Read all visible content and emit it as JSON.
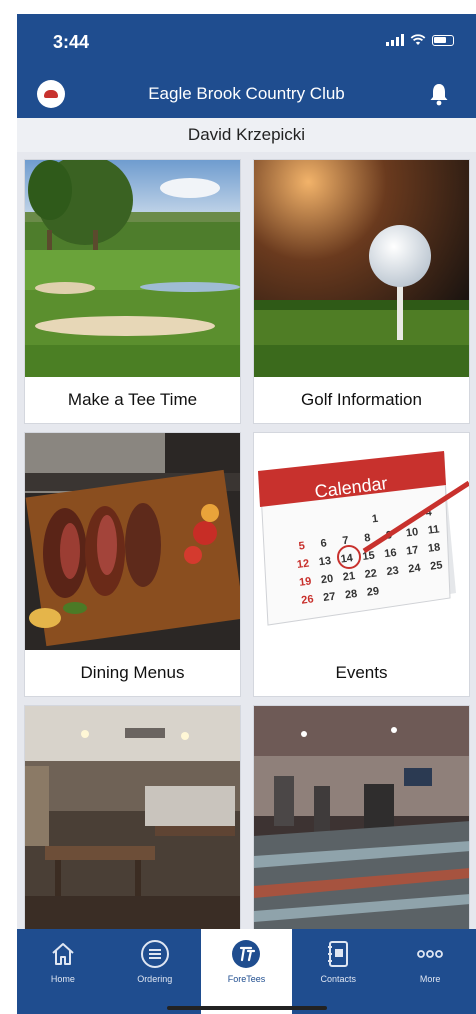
{
  "status_bar": {
    "time": "3:44"
  },
  "header": {
    "title": "Eagle Brook Country Club"
  },
  "user": {
    "name": "David Krzepicki"
  },
  "tiles": [
    {
      "label": "Make a Tee Time"
    },
    {
      "label": "Golf Information"
    },
    {
      "label": "Dining Menus"
    },
    {
      "label": "Events"
    },
    {
      "label": ""
    },
    {
      "label": ""
    }
  ],
  "calendar_image": {
    "title": "Calendar",
    "rows": [
      [
        "",
        "",
        "",
        "1",
        "",
        "4"
      ],
      [
        "5",
        "6",
        "7",
        "8",
        "9",
        "10",
        "11"
      ],
      [
        "12",
        "13",
        "14",
        "15",
        "16",
        "17",
        "18"
      ],
      [
        "19",
        "20",
        "21",
        "22",
        "23",
        "24",
        "25"
      ],
      [
        "26",
        "27",
        "28",
        "29"
      ]
    ]
  },
  "tabbar": {
    "items": [
      {
        "label": "Home",
        "icon": "home-icon"
      },
      {
        "label": "Ordering",
        "icon": "menu-lines-icon"
      },
      {
        "label": "ForeTees",
        "icon": "foretees-logo-icon"
      },
      {
        "label": "Contacts",
        "icon": "contacts-book-icon"
      },
      {
        "label": "More",
        "icon": "more-dots-icon"
      }
    ],
    "active": "ForeTees"
  },
  "colors": {
    "brand_blue": "#1f4d8f",
    "background": "#e6e8ee"
  }
}
